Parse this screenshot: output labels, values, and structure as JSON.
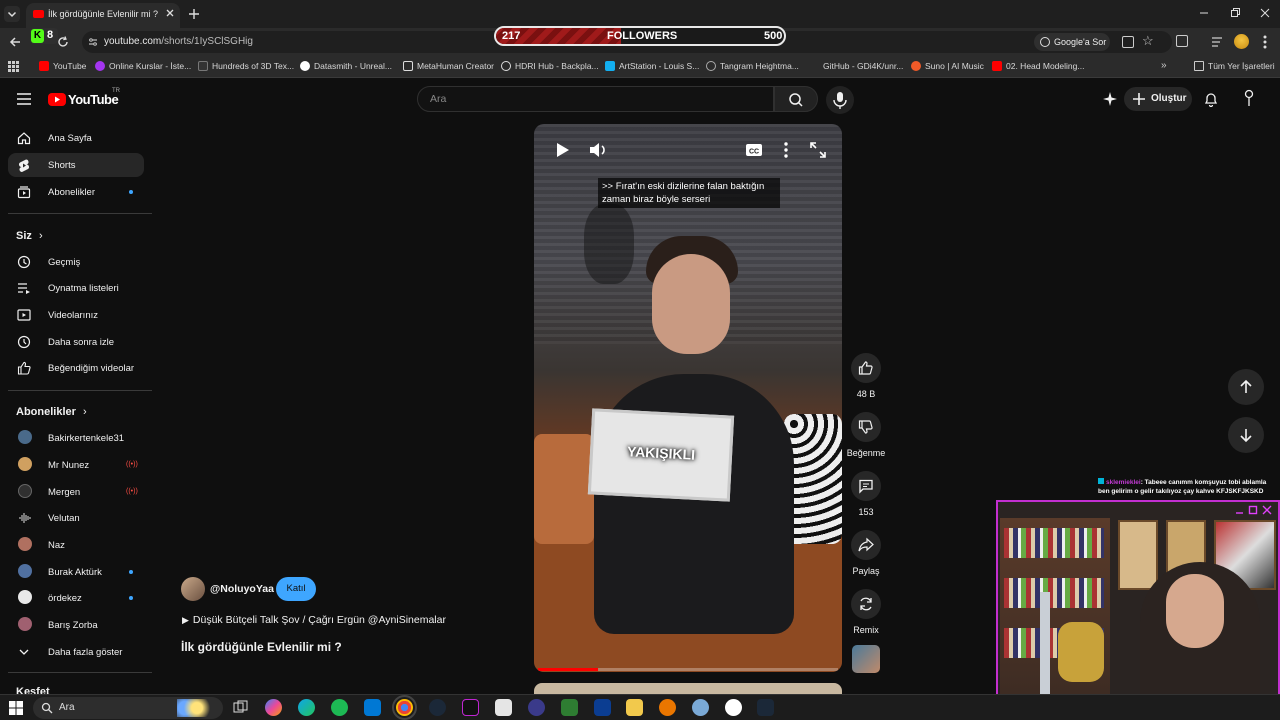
{
  "browser": {
    "tab_title": "İlk gördüğünle Evlenilir mi ? - Y",
    "url_host": "youtube.com",
    "url_path": "/shorts/1IySClSGHig",
    "ext_badge": "8",
    "google_btn": "Google'a Sor",
    "bookmarks": [
      {
        "label": "YouTube",
        "color": "#ff0000"
      },
      {
        "label": "Online Kurslar - İste...",
        "color": "#a435f0"
      },
      {
        "label": "Hundreds of 3D Tex...",
        "color": "#333333"
      },
      {
        "label": "Datasmith - Unreal...",
        "color": "#ffffff"
      },
      {
        "label": "MetaHuman Creator",
        "color": "#ffffff"
      },
      {
        "label": "HDRI Hub - Backpla...",
        "color": "#ffffff"
      },
      {
        "label": "ArtStation - Louis S...",
        "color": "#13aff0"
      },
      {
        "label": "Tangram Heightma...",
        "color": "#aaaaaa"
      },
      {
        "label": "GitHub - GDi4K/unr...",
        "color": "#ffffff"
      },
      {
        "label": "Suno | AI Music",
        "color": "#f05a28"
      },
      {
        "label": "02. Head Modeling...",
        "color": "#ff0000"
      }
    ],
    "all_bookmarks": "Tüm Yer İşaretleri"
  },
  "followers": {
    "current": "217",
    "label": "FOLLOWERS",
    "goal": "500",
    "progress": 0.434
  },
  "yt": {
    "logo_text": "YouTube",
    "logo_sup": "TR",
    "search_placeholder": "Ara",
    "create_label": "Oluştur"
  },
  "sidebar": {
    "main": [
      {
        "label": "Ana Sayfa",
        "icon": "home-icon"
      },
      {
        "label": "Shorts",
        "icon": "shorts-icon"
      },
      {
        "label": "Abonelikler",
        "icon": "subscriptions-icon"
      }
    ],
    "you_heading": "Siz",
    "you": [
      {
        "label": "Geçmiş",
        "icon": "history-icon"
      },
      {
        "label": "Oynatma listeleri",
        "icon": "playlist-icon"
      },
      {
        "label": "Videolarınız",
        "icon": "your-videos-icon"
      },
      {
        "label": "Daha sonra izle",
        "icon": "watch-later-icon"
      },
      {
        "label": "Beğendiğim videolar",
        "icon": "liked-icon"
      }
    ],
    "subs_heading": "Abonelikler",
    "subs": [
      {
        "label": "Bakirkertenkele31",
        "color": "#4a6a8a",
        "badge": "none"
      },
      {
        "label": "Mr Nunez",
        "color": "#d0a060",
        "badge": "live"
      },
      {
        "label": "Mergen",
        "color": "#303030",
        "badge": "live"
      },
      {
        "label": "Velutan",
        "color": "#0f0f0f",
        "badge": "none"
      },
      {
        "label": "Naz",
        "color": "#b07060",
        "badge": "none"
      },
      {
        "label": "Burak Aktürk",
        "color": "#5070a0",
        "badge": "dot"
      },
      {
        "label": "ördekez",
        "color": "#e8e8e8",
        "badge": "dot"
      },
      {
        "label": "Barış Zorba",
        "color": "#a06070",
        "badge": "none"
      }
    ],
    "show_more": "Daha fazla göster",
    "explore_heading": "Keşfet"
  },
  "short": {
    "caption": ">> Fırat'ın eski dizilerine falan baktığın zaman biraz böyle serseri",
    "board_text": "YAKIŞIKLI",
    "progress": 0.2,
    "channel": "@NoluyoYaa",
    "join_label": "Katıl",
    "playlist": "Düşük Bütçeli Talk Şov / Çağrı Ergün @AyniSinemalar",
    "title": "İlk gördüğünle Evlenilir mi ?",
    "likes": "48 B",
    "dislike_label": "Beğenme",
    "comments": "153",
    "share_label": "Paylaş",
    "remix_label": "Remix"
  },
  "chat": {
    "user": "sklemieklei",
    "message": ": Tabeee canımm komşuyuz tobi ablamla ben gelirim o gelir takılıyoz çay kahve KFJSKFJKSKD"
  },
  "taskbar": {
    "search_placeholder": "Ara"
  }
}
